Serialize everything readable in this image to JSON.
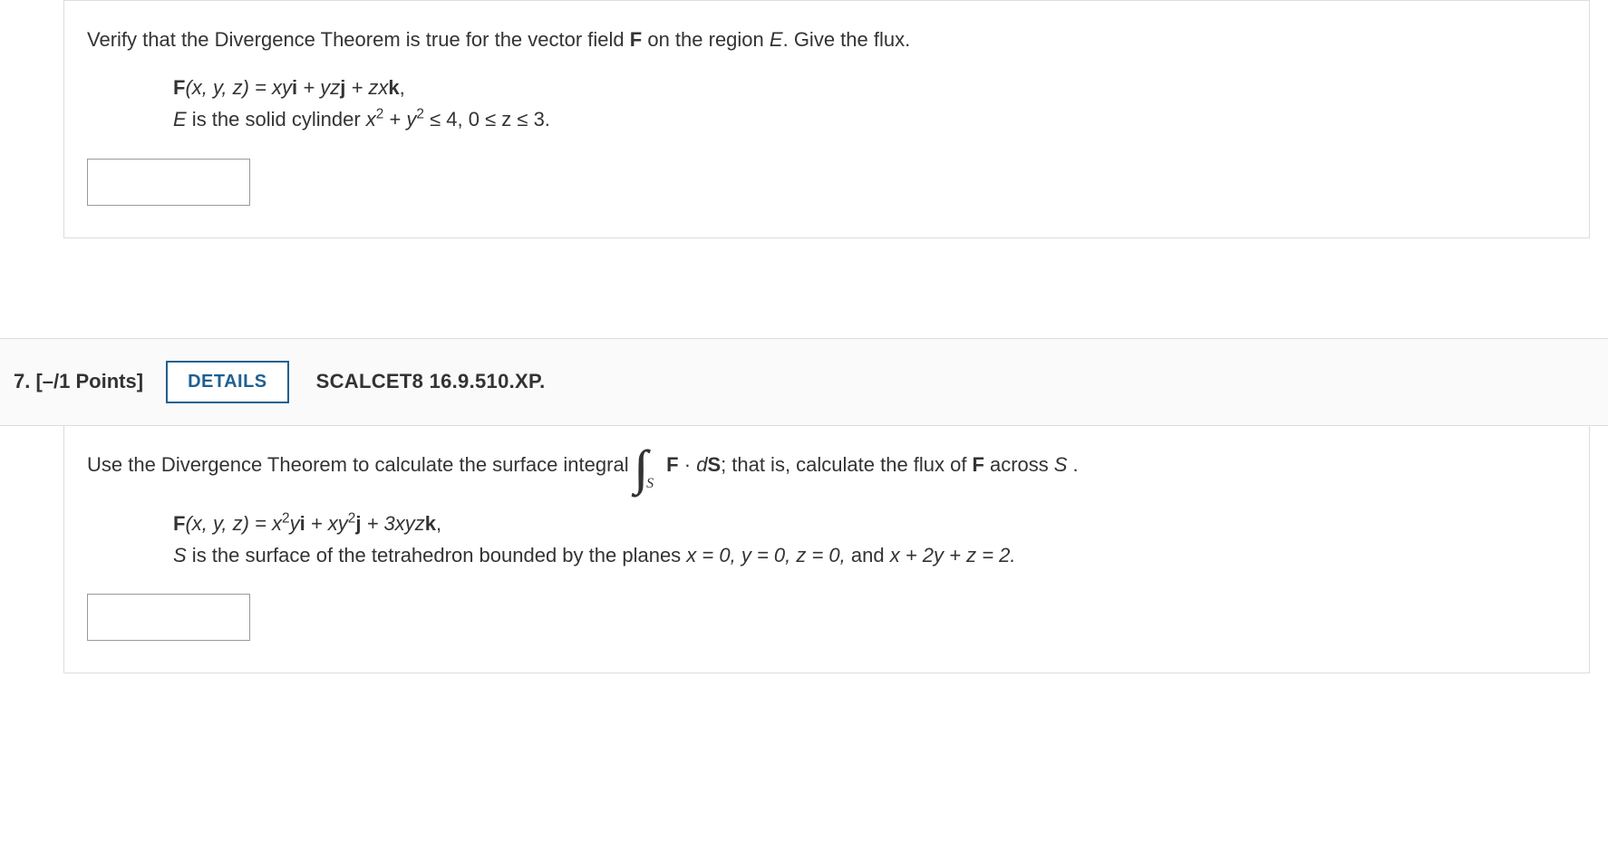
{
  "q6": {
    "prompt_pre": "Verify that the Divergence Theorem is true for the vector field ",
    "prompt_bold": "F",
    "prompt_mid": " on the region ",
    "prompt_italic": "E",
    "prompt_post": ". Give the flux.",
    "eq_F_lhs": "F",
    "eq_F_args": "(x, y, z) = xy",
    "eq_F_i": "i",
    "eq_F_plus1": " + yz",
    "eq_F_j": "j",
    "eq_F_plus2": " + zx",
    "eq_F_k": "k",
    "eq_F_comma": ",",
    "eq_E_pre": "E",
    "eq_E_text": " is the solid cylinder  ",
    "eq_E_math_x": "x",
    "eq_E_sup1": "2",
    "eq_E_plus": " + ",
    "eq_E_math_y": "y",
    "eq_E_sup2": "2",
    "eq_E_rest": " ≤ 4,  0 ≤ z ≤ 3."
  },
  "q7": {
    "header_number": "7.",
    "header_points": "[–/1 Points]",
    "details_label": "DETAILS",
    "source_ref": "SCALCET8 16.9.510.XP.",
    "prompt_pre": "Use the Divergence Theorem to calculate the surface integral  ",
    "int_F": "F",
    "int_dot": " · ",
    "int_dS": "dS",
    "int_semicolon": ";",
    "int_sub": "S",
    "prompt_mid": "  that is, calculate the flux of ",
    "prompt_F": "F",
    "prompt_across": " across ",
    "prompt_S": "S",
    "prompt_period": ".",
    "eq_F_lhs": "F",
    "eq_open": "(x, y, z) = x",
    "eq_sup1": "2",
    "eq_p1": "y",
    "eq_i": "i",
    "eq_plus1": " + xy",
    "eq_sup2": "2",
    "eq_j": "j",
    "eq_plus2": " + 3xyz",
    "eq_k": "k",
    "eq_comma": ",",
    "eq_S_pre": "S",
    "eq_S_text": " is the surface of the tetrahedron bounded by the planes ",
    "eq_S_math": "x = 0, y = 0, z = 0,",
    "eq_S_and": " and  ",
    "eq_S_last": "x + 2y + z = 2."
  }
}
